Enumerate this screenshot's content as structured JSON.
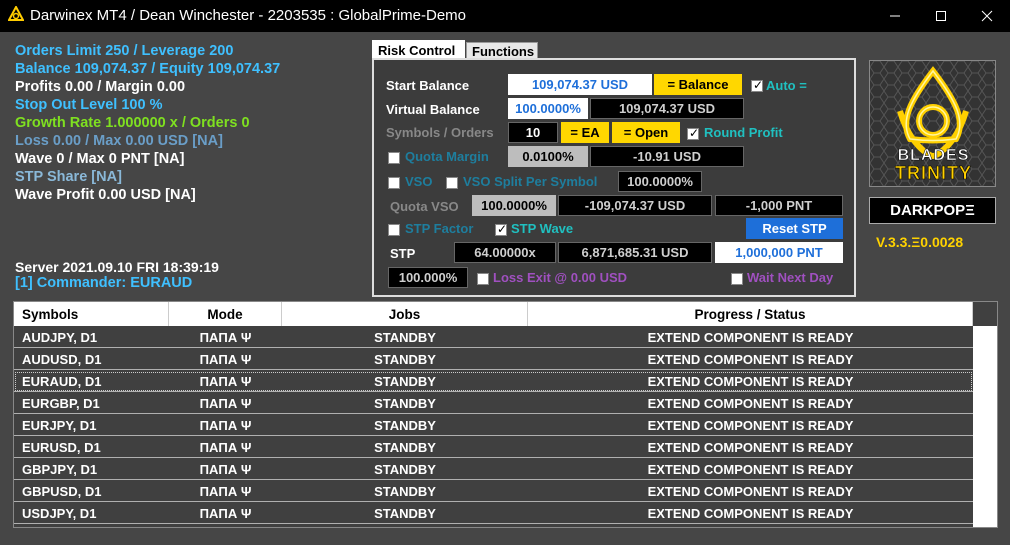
{
  "window": {
    "title": "Darwinex MT4 / Dean Winchester - 2203535 : GlobalPrime-Demo"
  },
  "status": {
    "orders_limit": "Orders Limit 250 / Leverage 200",
    "balance": "Balance 109,074.37 / Equity 109,074.37",
    "profits": "Profits 0.00 / Margin 0.00",
    "stop_out": "Stop Out Level 100 %",
    "growth": "Growth Rate 1.000000 x / Orders 0",
    "loss": "Loss 0.00 / Max 0.00 USD [NA]",
    "wave": "Wave 0 / Max 0 PNT [NA]",
    "stp_share": "STP Share [NA]",
    "wave_profit": "Wave Profit 0.00 USD [NA]",
    "server": "Server 2021.09.10 FRI 18:39:19",
    "commander": "[1] Commander: EURAUD"
  },
  "tabs": [
    "Risk Control",
    "Functions"
  ],
  "risk": {
    "start_balance_label": "Start Balance",
    "start_balance_value": "109,074.37 USD",
    "eq_balance_btn": "= Balance",
    "auto_label": "Auto =",
    "virtual_balance_label": "Virtual Balance",
    "virtual_pct": "100.0000%",
    "virtual_value": "109,074.37 USD",
    "symbols_orders_label": "Symbols / Orders",
    "symbols_count": "10",
    "eq_ea_btn": "= EA",
    "eq_open_btn": "= Open",
    "round_profit_label": "Round Profit",
    "quota_margin_label": "Quota Margin",
    "quota_pct": "0.0100%",
    "quota_value": "-10.91 USD",
    "vso_label": "VSO",
    "vso_split_label": "VSO Split Per Symbol",
    "vso_split_pct": "100.0000%",
    "quota_vso_label": "Quota VSO",
    "quota_vso_pct": "100.0000%",
    "quota_vso_usd": "-109,074.37 USD",
    "quota_vso_pnt": "-1,000 PNT",
    "stp_factor_label": "STP Factor",
    "stp_wave_label": "STP Wave",
    "reset_stp_btn": "Reset STP",
    "stp_label": "STP",
    "stp_mult": "64.00000x",
    "stp_usd": "6,871,685.31 USD",
    "stp_pnt": "1,000,000 PNT",
    "loss_pct": "100.000%",
    "loss_exit_label": "Loss Exit @ 0.00 USD",
    "wait_next_day_label": "Wait Next Day"
  },
  "logo": {
    "line1": "BLADES",
    "line2": "TRINITY"
  },
  "darkpope": "DARKPOPΞ",
  "version": "V.3.3.Ξ0.0028",
  "table": {
    "headers": [
      "Symbols",
      "Mode",
      "Jobs",
      "Progress / Status"
    ],
    "rows": [
      [
        "AUDJPY, D1",
        "ΠΑΠΑ Ψ",
        "STANDBY",
        "EXTEND COMPONENT IS READY"
      ],
      [
        "AUDUSD, D1",
        "ΠΑΠΑ Ψ",
        "STANDBY",
        "EXTEND COMPONENT IS READY"
      ],
      [
        "EURAUD, D1",
        "ΠΑΠΑ Ψ",
        "STANDBY",
        "EXTEND COMPONENT IS READY"
      ],
      [
        "EURGBP, D1",
        "ΠΑΠΑ Ψ",
        "STANDBY",
        "EXTEND COMPONENT IS READY"
      ],
      [
        "EURJPY, D1",
        "ΠΑΠΑ Ψ",
        "STANDBY",
        "EXTEND COMPONENT IS READY"
      ],
      [
        "EURUSD, D1",
        "ΠΑΠΑ Ψ",
        "STANDBY",
        "EXTEND COMPONENT IS READY"
      ],
      [
        "GBPJPY, D1",
        "ΠΑΠΑ Ψ",
        "STANDBY",
        "EXTEND COMPONENT IS READY"
      ],
      [
        "GBPUSD, D1",
        "ΠΑΠΑ Ψ",
        "STANDBY",
        "EXTEND COMPONENT IS READY"
      ],
      [
        "USDJPY, D1",
        "ΠΑΠΑ Ψ",
        "STANDBY",
        "EXTEND COMPONENT IS READY"
      ]
    ]
  },
  "colors": {
    "cyan": "#3fc0ff",
    "green": "#7fe020",
    "teal": "#20c0c0",
    "purple": "#a050c0",
    "gold": "#ffd200"
  }
}
